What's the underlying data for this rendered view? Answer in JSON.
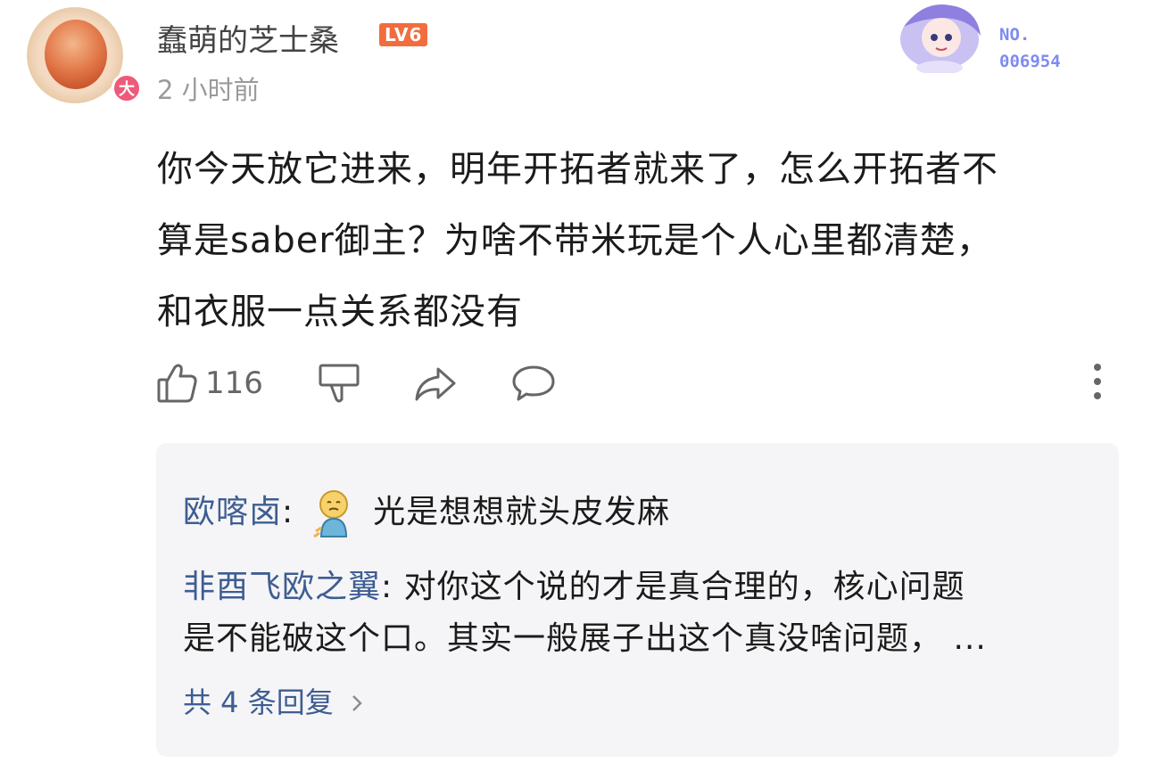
{
  "comment": {
    "username": "蠢萌的芝士桑",
    "level_badge": "LV6",
    "avatar_badge": "大",
    "time": "2 小时前",
    "deco_number_label": "NO.",
    "deco_number": "006954",
    "content_lines": [
      "你今天放它进来，明年开拓者就来了，怎么开拓者不",
      "算是saber御主？为啥不带米玩是个人心里都清楚，",
      "和衣服一点关系都没有"
    ],
    "like_count": "116"
  },
  "replies": [
    {
      "author": "欧喀卤",
      "sep": ":",
      "text": "光是想想就头皮发麻"
    },
    {
      "author": "非酉飞欧之翼",
      "sep": ":",
      "text_line1": "对你这个说的才是真合理的，核心问题",
      "text_line2": "是不能破这个口。其实一般展子出这个真没啥问题，  ..."
    }
  ],
  "reply_footer": "共 4 条回复",
  "colors": {
    "accent_link": "#3e5d92",
    "level_badge": "#f26d3d",
    "background_box": "#f5f5f7"
  }
}
